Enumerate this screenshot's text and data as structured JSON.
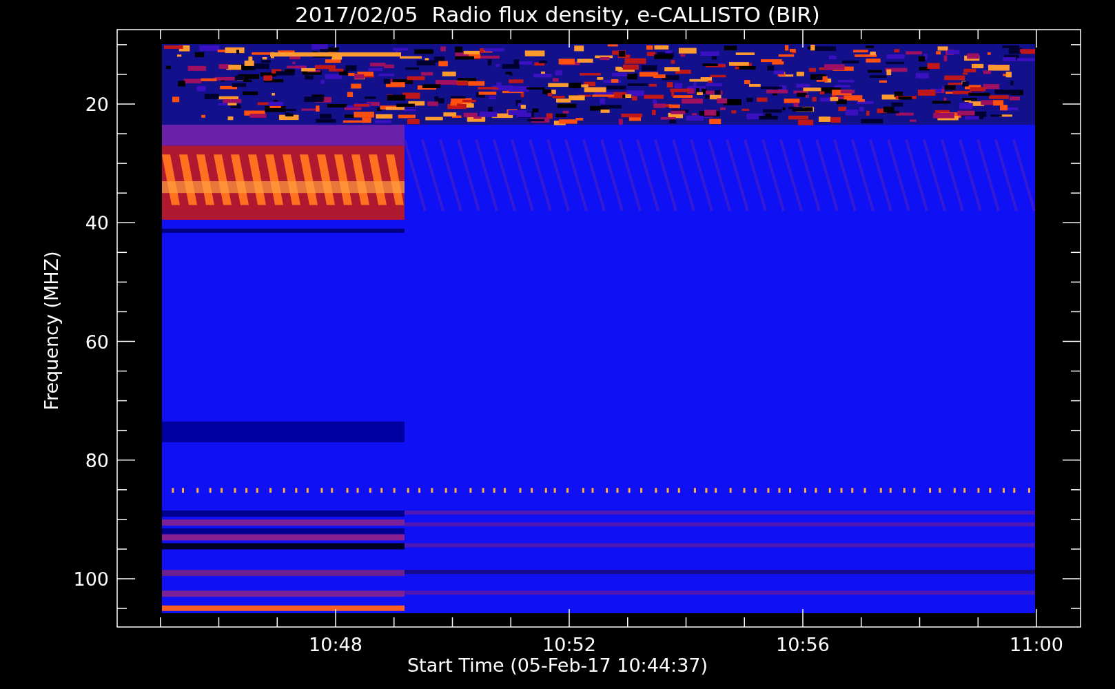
{
  "title": "2017/02/05  Radio flux density, e-CALLISTO (BIR)",
  "y_axis": {
    "label": "Frequency (MHZ)",
    "ticks": [
      "20",
      "40",
      "60",
      "80",
      "100"
    ]
  },
  "x_axis": {
    "label": "Start Time (05-Feb-17 10:44:37)",
    "ticks": [
      "10:48",
      "10:52",
      "10:56",
      "11:00"
    ]
  }
}
